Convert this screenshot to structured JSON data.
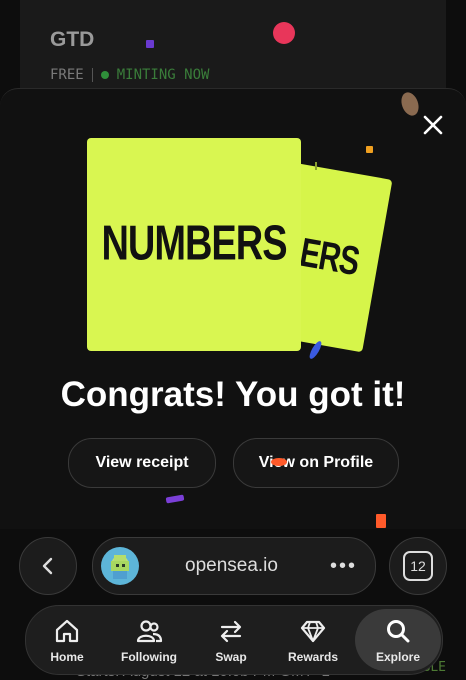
{
  "background_page": {
    "title": "GTD",
    "price": "FREE",
    "status": "MINTING NOW",
    "lower_row_label": "Starts: August 12 at 10:0b PM GMT+1",
    "lower_right_badge": "ELIGIBLE"
  },
  "modal": {
    "card_front_text": "NUMBERS",
    "card_back_text": "ERS",
    "headline": "Congrats! You got it!",
    "buttons": {
      "receipt": "View receipt",
      "profile": "View on Profile"
    }
  },
  "browser": {
    "url": "opensea.io",
    "more": "•••",
    "tab_count": "12"
  },
  "nav": {
    "items": [
      {
        "label": "Home",
        "icon": "home-icon"
      },
      {
        "label": "Following",
        "icon": "users-icon"
      },
      {
        "label": "Swap",
        "icon": "swap-icon"
      },
      {
        "label": "Rewards",
        "icon": "diamond-icon"
      },
      {
        "label": "Explore",
        "icon": "search-icon"
      }
    ],
    "active": "Explore"
  },
  "colors": {
    "card": "#d9f651",
    "confetti_pink": "#e8365a",
    "confetti_purple": "#7b3fd8",
    "confetti_orange": "#ff5a2a"
  }
}
